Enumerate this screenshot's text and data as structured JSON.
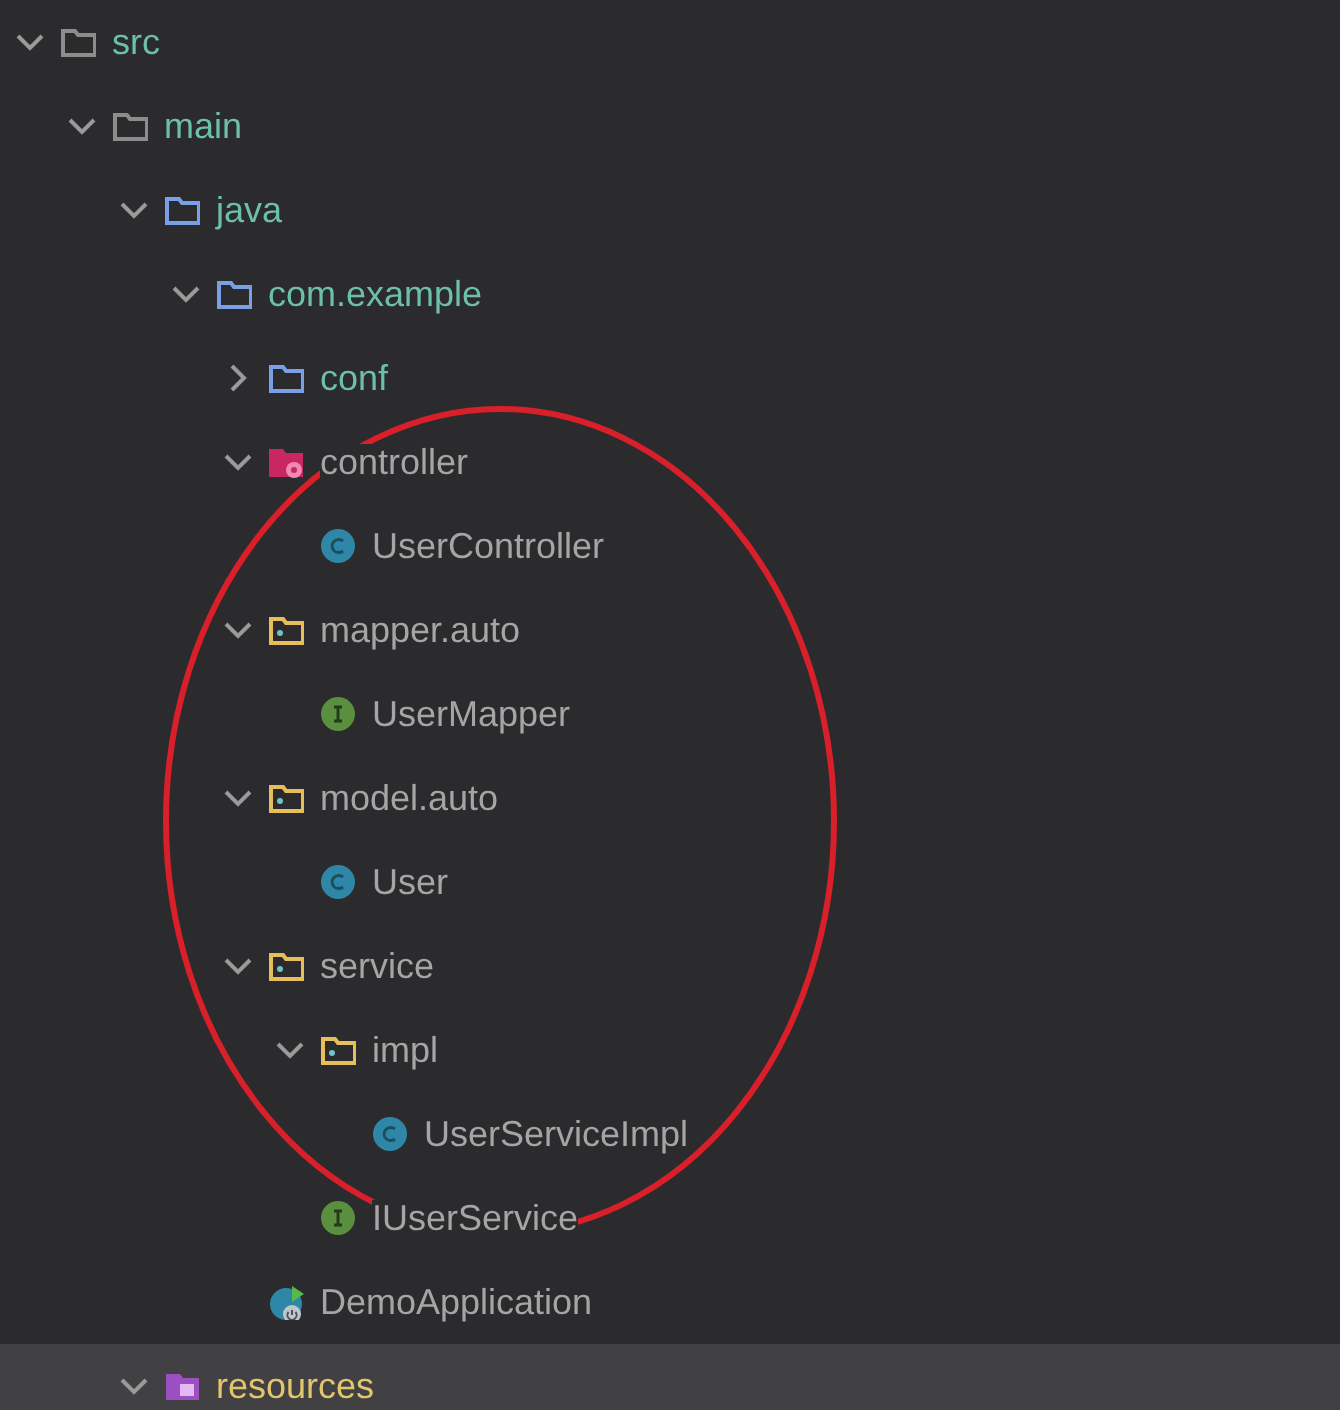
{
  "tree": [
    {
      "label": "src",
      "kind": "folder_plain",
      "color": "#6cbfa9",
      "expanded": true,
      "selected": false,
      "children": [
        {
          "label": "main",
          "kind": "folder_plain",
          "color": "#6cbfa9",
          "expanded": true,
          "selected": false,
          "children": [
            {
              "label": "java",
              "kind": "folder_source",
              "color": "#6cbfa9",
              "expanded": true,
              "selected": false,
              "children": [
                {
                  "label": "com.example",
                  "kind": "folder_source",
                  "color": "#6cbfa9",
                  "expanded": true,
                  "selected": false,
                  "children": [
                    {
                      "label": "conf",
                      "kind": "folder_source",
                      "color": "#6cbfa9",
                      "expanded": false,
                      "selected": false
                    },
                    {
                      "label": "controller",
                      "kind": "folder_controller",
                      "color": "#a5a5a5",
                      "expanded": true,
                      "selected": false,
                      "children": [
                        {
                          "label": "UserController",
                          "kind": "class",
                          "color": "#a5a5a5",
                          "selected": false
                        }
                      ]
                    },
                    {
                      "label": "mapper.auto",
                      "kind": "folder_package",
                      "color": "#a5a5a5",
                      "expanded": true,
                      "selected": false,
                      "children": [
                        {
                          "label": "UserMapper",
                          "kind": "interface",
                          "color": "#a5a5a5",
                          "selected": false
                        }
                      ]
                    },
                    {
                      "label": "model.auto",
                      "kind": "folder_package",
                      "color": "#a5a5a5",
                      "expanded": true,
                      "selected": false,
                      "children": [
                        {
                          "label": "User",
                          "kind": "class",
                          "color": "#a5a5a5",
                          "selected": false
                        }
                      ]
                    },
                    {
                      "label": "service",
                      "kind": "folder_package",
                      "color": "#a5a5a5",
                      "expanded": true,
                      "selected": false,
                      "children": [
                        {
                          "label": "impl",
                          "kind": "folder_package",
                          "color": "#a5a5a5",
                          "expanded": true,
                          "selected": false,
                          "children": [
                            {
                              "label": "UserServiceImpl",
                              "kind": "class",
                              "color": "#a5a5a5",
                              "selected": false
                            }
                          ]
                        },
                        {
                          "label": "IUserService",
                          "kind": "interface",
                          "color": "#a5a5a5",
                          "selected": false
                        }
                      ]
                    },
                    {
                      "label": "DemoApplication",
                      "kind": "spring_app",
                      "color": "#a5a5a5",
                      "selected": false
                    }
                  ]
                }
              ]
            },
            {
              "label": "resources",
              "kind": "folder_resources",
              "color": "#e3c56c",
              "expanded": true,
              "selected": true
            }
          ]
        }
      ]
    }
  ],
  "annotation": {
    "kind": "ellipse",
    "color": "#d9202a"
  }
}
